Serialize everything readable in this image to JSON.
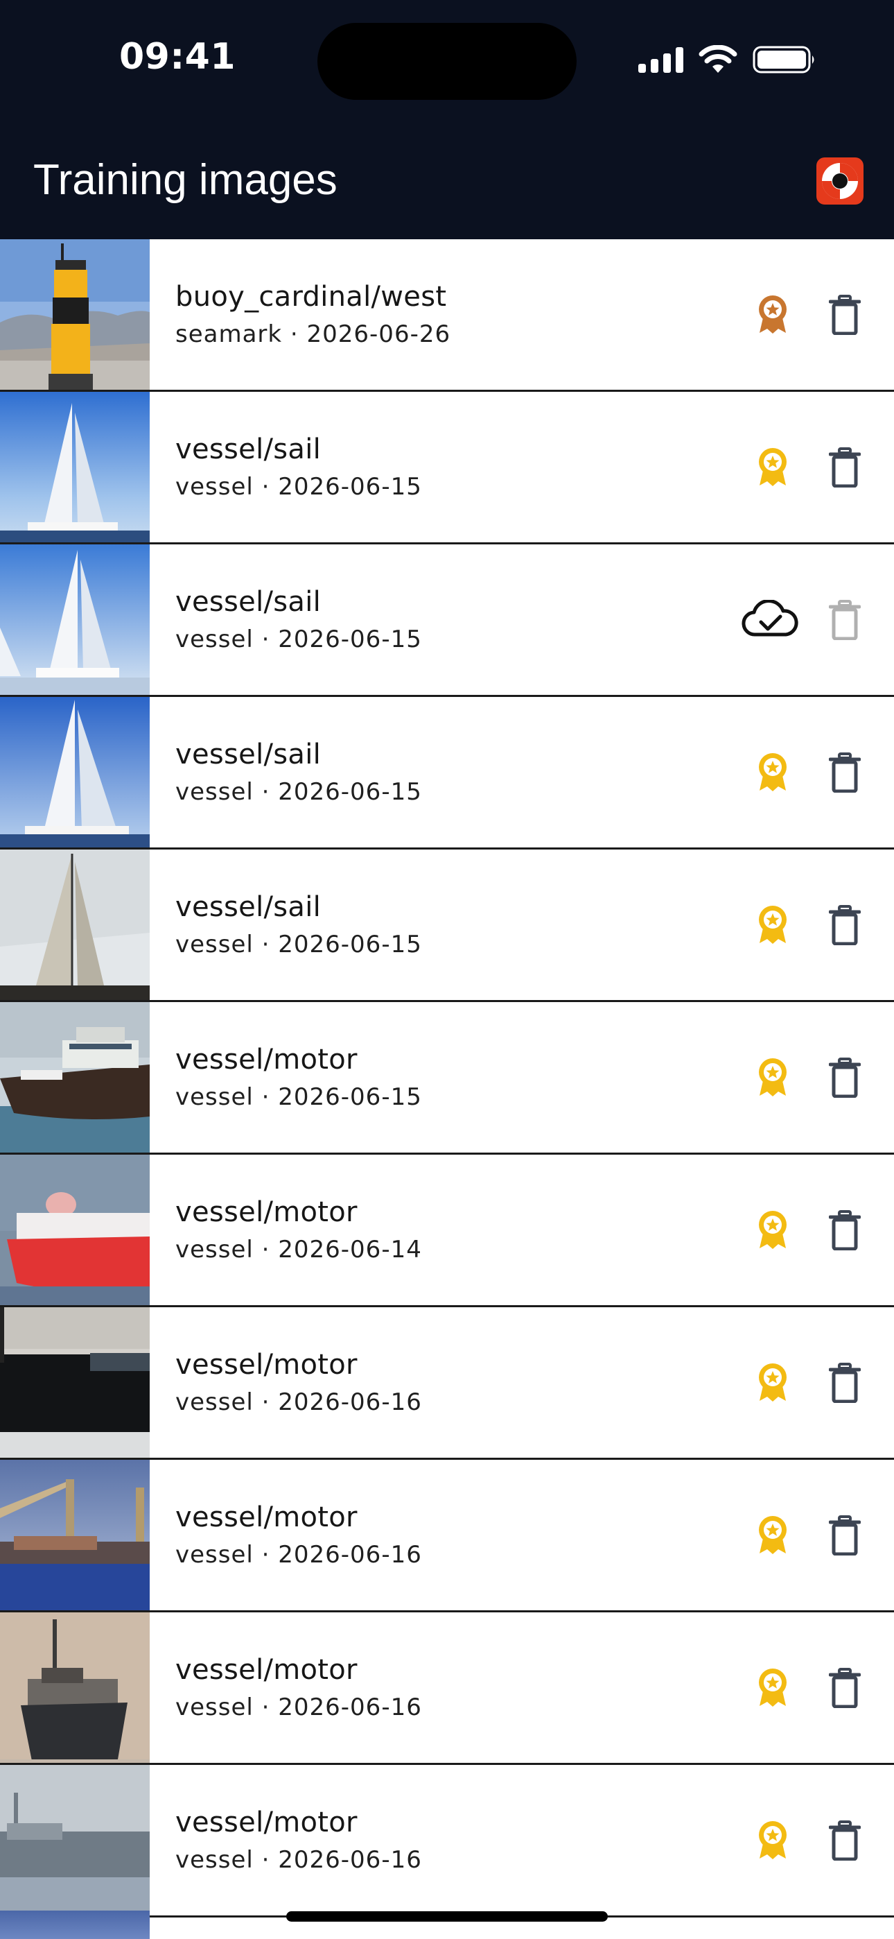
{
  "status_bar": {
    "time": "09:41"
  },
  "header": {
    "title": "Training images",
    "help_icon": "lifebuoy-icon",
    "background": "#0b1120"
  },
  "colors": {
    "bronze": "#c8762f",
    "gold": "#f3bb12",
    "trash": "#3d4553",
    "trash_disabled": "#b0b0b0",
    "cloud": "#111111"
  },
  "items": [
    {
      "label": "buoy_cardinal/west",
      "category": "seamark",
      "date": "2026-06-26",
      "subtitle": "seamark · 2026-06-26",
      "badge": "bronze-award-icon",
      "badge_color": "#c8762f",
      "synced": false,
      "delete_enabled": true,
      "thumb": "buoy"
    },
    {
      "label": "vessel/sail",
      "category": "vessel",
      "date": "2026-06-15",
      "subtitle": "vessel · 2026-06-15",
      "badge": "gold-award-icon",
      "badge_color": "#f3bb12",
      "synced": false,
      "delete_enabled": true,
      "thumb": "sail1"
    },
    {
      "label": "vessel/sail",
      "category": "vessel",
      "date": "2026-06-15",
      "subtitle": "vessel · 2026-06-15",
      "badge": "cloud-check-icon",
      "badge_color": "#111111",
      "synced": true,
      "delete_enabled": false,
      "thumb": "sail2"
    },
    {
      "label": "vessel/sail",
      "category": "vessel",
      "date": "2026-06-15",
      "subtitle": "vessel · 2026-06-15",
      "badge": "gold-award-icon",
      "badge_color": "#f3bb12",
      "synced": false,
      "delete_enabled": true,
      "thumb": "sail3"
    },
    {
      "label": "vessel/sail",
      "category": "vessel",
      "date": "2026-06-15",
      "subtitle": "vessel · 2026-06-15",
      "badge": "gold-award-icon",
      "badge_color": "#f3bb12",
      "synced": false,
      "delete_enabled": true,
      "thumb": "sail4"
    },
    {
      "label": "vessel/motor",
      "category": "vessel",
      "date": "2026-06-15",
      "subtitle": "vessel · 2026-06-15",
      "badge": "gold-award-icon",
      "badge_color": "#f3bb12",
      "synced": false,
      "delete_enabled": true,
      "thumb": "motor1"
    },
    {
      "label": "vessel/motor",
      "category": "vessel",
      "date": "2026-06-14",
      "subtitle": "vessel · 2026-06-14",
      "badge": "gold-award-icon",
      "badge_color": "#f3bb12",
      "synced": false,
      "delete_enabled": true,
      "thumb": "motor2"
    },
    {
      "label": "vessel/motor",
      "category": "vessel",
      "date": "2026-06-16",
      "subtitle": "vessel · 2026-06-16",
      "badge": "gold-award-icon",
      "badge_color": "#f3bb12",
      "synced": false,
      "delete_enabled": true,
      "thumb": "motor3"
    },
    {
      "label": "vessel/motor",
      "category": "vessel",
      "date": "2026-06-16",
      "subtitle": "vessel · 2026-06-16",
      "badge": "gold-award-icon",
      "badge_color": "#f3bb12",
      "synced": false,
      "delete_enabled": true,
      "thumb": "motor4"
    },
    {
      "label": "vessel/motor",
      "category": "vessel",
      "date": "2026-06-16",
      "subtitle": "vessel · 2026-06-16",
      "badge": "gold-award-icon",
      "badge_color": "#f3bb12",
      "synced": false,
      "delete_enabled": true,
      "thumb": "motor5"
    },
    {
      "label": "vessel/motor",
      "category": "vessel",
      "date": "2026-06-16",
      "subtitle": "vessel · 2026-06-16",
      "badge": "gold-award-icon",
      "badge_color": "#f3bb12",
      "synced": false,
      "delete_enabled": true,
      "thumb": "motor6"
    }
  ]
}
